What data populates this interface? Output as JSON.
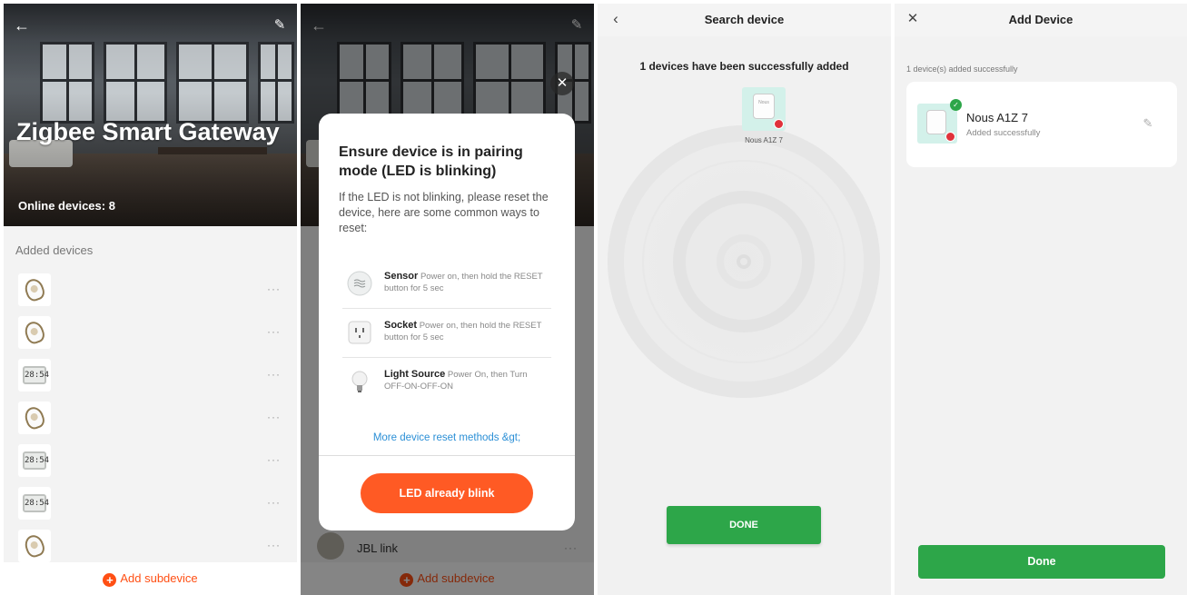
{
  "gateway": {
    "title": "Zigbee Smart Gateway",
    "online_devices": "Online devices: 8",
    "added_devices_label": "Added devices",
    "more_dots": "···",
    "thermo_reading": "28:54",
    "devices": [
      {
        "kind": "plug"
      },
      {
        "kind": "plug"
      },
      {
        "kind": "thermometer"
      },
      {
        "kind": "plug"
      },
      {
        "kind": "thermometer"
      },
      {
        "kind": "thermometer"
      },
      {
        "kind": "plug"
      }
    ],
    "add_subdevice": "Add subdevice",
    "jbl_label": "JBL link",
    "icons": {
      "back": "back-arrow-icon",
      "edit": "edit-pencil-icon"
    }
  },
  "pairing_modal": {
    "title": "Ensure device is in pairing mode (LED is blinking)",
    "body": "If the LED is not blinking, please reset the device, here are some common ways to reset:",
    "methods": [
      {
        "name": "Sensor",
        "desc": "Power on, then hold the RESET button for 5 sec",
        "icon": "sensor-icon"
      },
      {
        "name": "Socket",
        "desc": "Power on, then hold the RESET button for 5 sec",
        "icon": "socket-icon"
      },
      {
        "name": "Light Source",
        "desc": "Power On, then Turn OFF-ON-OFF-ON",
        "icon": "bulb-icon"
      }
    ],
    "more_link": "More device reset methods &gt;",
    "confirm_button": "LED already blink"
  },
  "search": {
    "title": "Search device",
    "found_text": "1 devices have been successfully added",
    "device_name": "Nous A1Z 7",
    "thumb_label": "Nous",
    "done_button": "DONE"
  },
  "add_device": {
    "title": "Add Device",
    "success_note": "1 device(s) added successfully",
    "device_name": "Nous A1Z  7",
    "device_status": "Added successfully",
    "done_button": "Done"
  },
  "colors": {
    "accent_orange": "#ff5a24",
    "link_blue": "#2b8fd6",
    "success_green": "#2da649",
    "badge_red": "#e0323b"
  }
}
